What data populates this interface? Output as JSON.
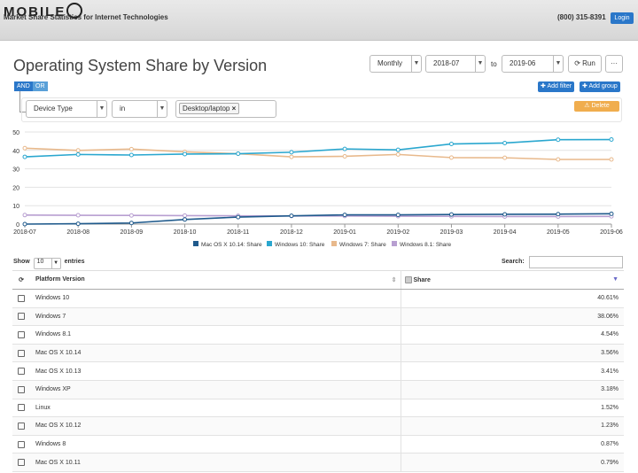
{
  "header": {
    "logo_text": "MOBILE",
    "tagline": "Market Share Statistics for Internet Technologies",
    "phone": "(800) 315-8391",
    "login_label": "Login"
  },
  "page_title": "Operating System Share by Version",
  "toolbar": {
    "granularity": "Monthly",
    "date_from": "2018-07",
    "to_label": "to",
    "date_to": "2019-06",
    "run_label": "Run",
    "more_label": "···"
  },
  "filter": {
    "and_label": "AND",
    "or_label": "OR",
    "add_filter_label": "Add filter",
    "add_group_label": "Add group",
    "field": "Device Type",
    "operator": "in",
    "value_tag": "Desktop/laptop",
    "tag_remove": "×",
    "delete_label": "Delete"
  },
  "chart_data": {
    "type": "line",
    "x": [
      "2018-07",
      "2018-08",
      "2018-09",
      "2018-10",
      "2018-11",
      "2018-12",
      "2019-01",
      "2019-02",
      "2019-03",
      "2019-04",
      "2019-05",
      "2019-06"
    ],
    "ylim": [
      0,
      50
    ],
    "yticks": [
      "0",
      "10",
      "20",
      "30",
      "40",
      "50"
    ],
    "grid": true,
    "legend_position": "bottom",
    "series": [
      {
        "name": "Mac OS X 10.14: Share",
        "color": "#1f5a8c",
        "values": [
          0,
          0.2,
          0.6,
          2.5,
          3.8,
          4.5,
          5.0,
          5.0,
          5.2,
          5.3,
          5.4,
          5.6
        ]
      },
      {
        "name": "Windows 10: Share",
        "color": "#2aa7cf",
        "values": [
          36.5,
          37.8,
          37.5,
          38.0,
          38.2,
          39.0,
          40.8,
          40.3,
          43.5,
          44.0,
          45.8,
          45.9
        ]
      },
      {
        "name": "Windows 7: Share",
        "color": "#e8b98c",
        "values": [
          41.2,
          40.0,
          40.7,
          39.2,
          38.2,
          36.5,
          36.8,
          37.8,
          36.1,
          36.0,
          35.1,
          35.1
        ]
      },
      {
        "name": "Windows 8.1: Share",
        "color": "#b89fd1",
        "values": [
          4.9,
          4.8,
          4.7,
          4.6,
          4.5,
          4.4,
          4.4,
          4.3,
          4.2,
          4.1,
          4.1,
          4.2
        ]
      }
    ]
  },
  "table_controls": {
    "show_label": "Show",
    "page_size": "10",
    "entries_label": "entries",
    "search_label": "Search:"
  },
  "table": {
    "col_version": "Platform Version",
    "col_share": "Share",
    "rows": [
      {
        "version": "Windows 10",
        "share": "40.61%"
      },
      {
        "version": "Windows 7",
        "share": "38.06%"
      },
      {
        "version": "Windows 8.1",
        "share": "4.54%"
      },
      {
        "version": "Mac OS X 10.14",
        "share": "3.56%"
      },
      {
        "version": "Mac OS X 10.13",
        "share": "3.41%"
      },
      {
        "version": "Windows XP",
        "share": "3.18%"
      },
      {
        "version": "Linux",
        "share": "1.52%"
      },
      {
        "version": "Mac OS X 10.12",
        "share": "1.23%"
      },
      {
        "version": "Windows 8",
        "share": "0.87%"
      },
      {
        "version": "Mac OS X 10.11",
        "share": "0.79%"
      }
    ]
  }
}
